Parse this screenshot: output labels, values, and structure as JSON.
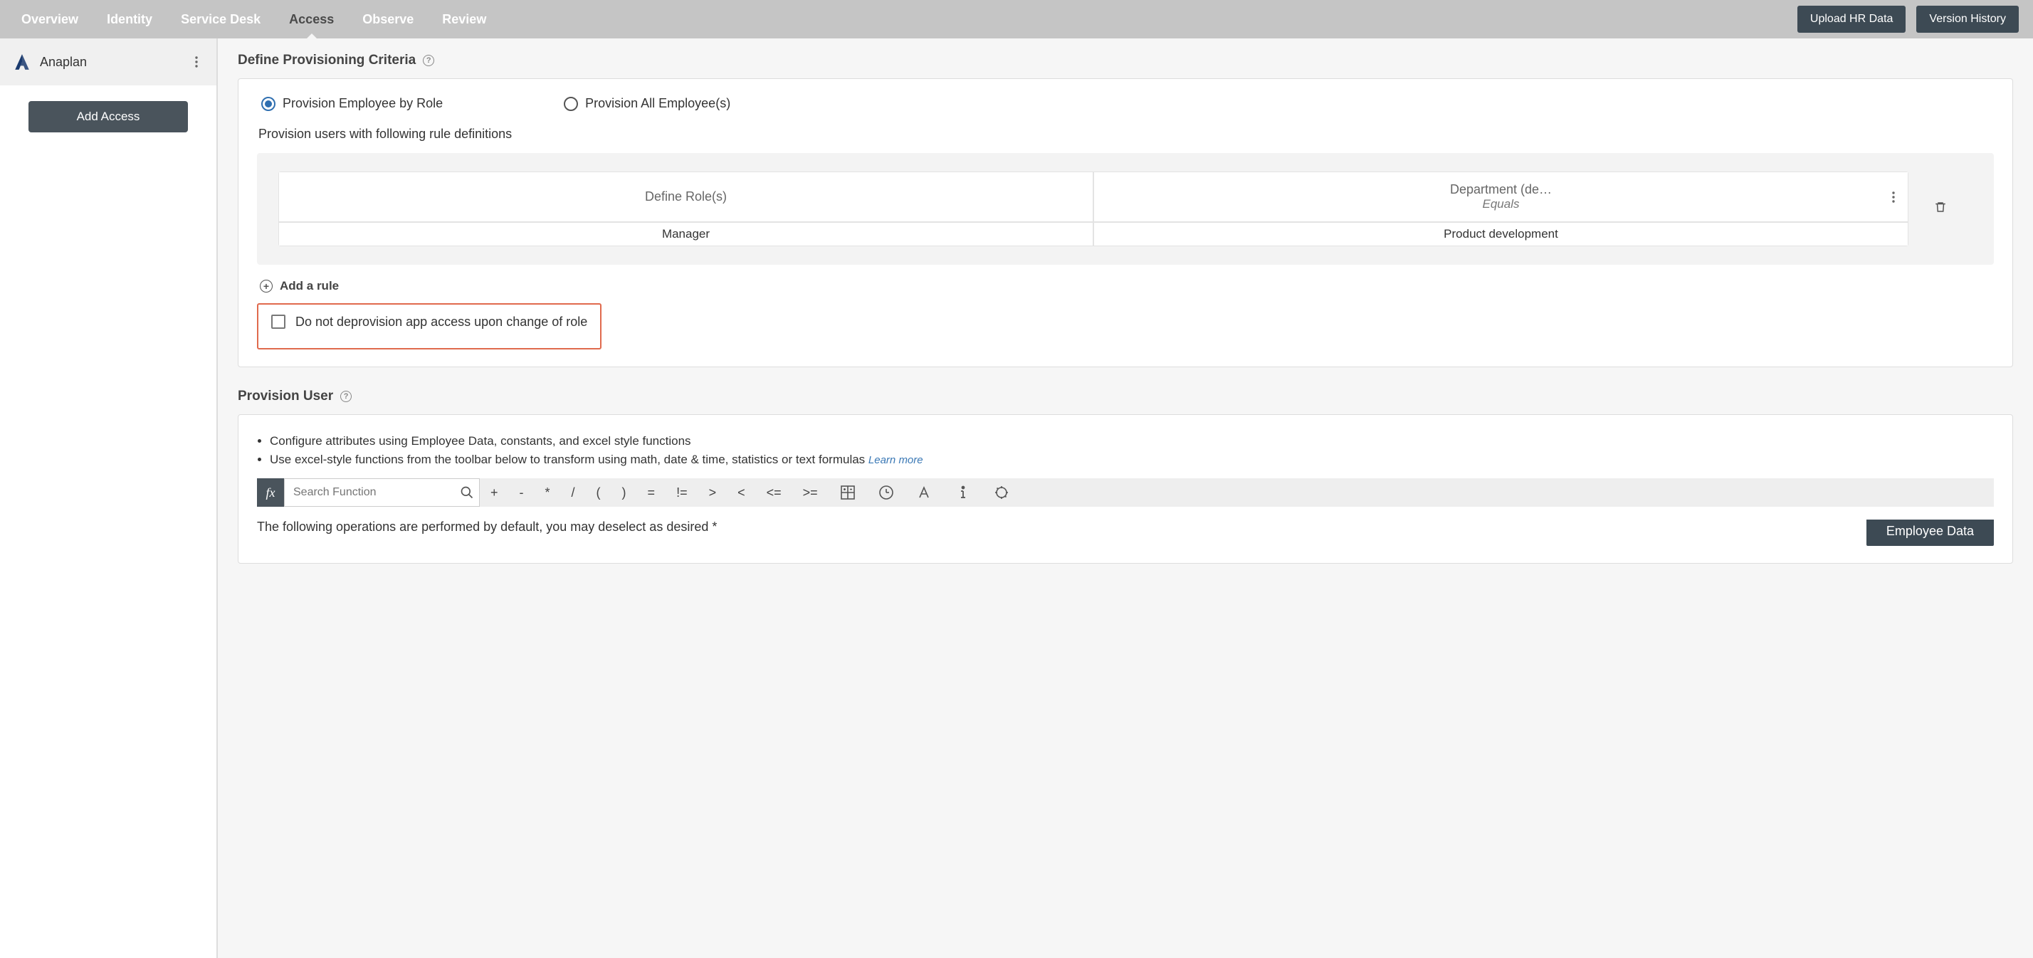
{
  "nav": {
    "tabs": [
      "Overview",
      "Identity",
      "Service Desk",
      "Access",
      "Observe",
      "Review"
    ],
    "active": "Access",
    "upload": "Upload HR Data",
    "version": "Version History"
  },
  "sidebar": {
    "app_name": "Anaplan",
    "add_access": "Add Access"
  },
  "criteria": {
    "title": "Define Provisioning Criteria",
    "radio_by_role": "Provision Employee by Role",
    "radio_all": "Provision All Employee(s)",
    "rule_intro": "Provision users with following rule definitions",
    "col_roles": "Define Role(s)",
    "col_dept": "Department (de…",
    "col_dept_sub": "Equals",
    "row_role": "Manager",
    "row_dept": "Product development",
    "add_rule": "Add a rule",
    "deprov": "Do not deprovision app access upon change of role"
  },
  "provision_user": {
    "title": "Provision User",
    "bullet1": "Configure attributes using Employee Data, constants, and excel style functions",
    "bullet2": "Use excel-style functions from the toolbar below to transform using math, date & time, statistics or text formulas",
    "learn_more": "Learn more",
    "search_placeholder": "Search Function",
    "ops": [
      "+",
      "-",
      "*",
      "/",
      "(",
      ")",
      "=",
      "!=",
      ">",
      "<",
      "<=",
      ">="
    ],
    "default_ops": "The following operations are performed by default, you may deselect as desired *",
    "emp_data": "Employee Data"
  }
}
